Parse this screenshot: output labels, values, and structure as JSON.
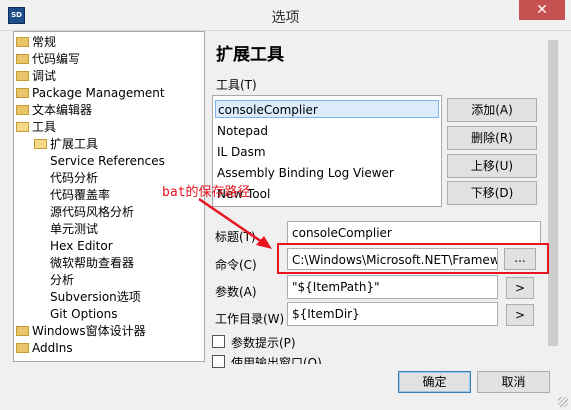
{
  "window": {
    "title": "选项",
    "icon_text": "SD",
    "close_label": "✕"
  },
  "tree": {
    "items": [
      {
        "label": "常规",
        "level": 0
      },
      {
        "label": "代码编写",
        "level": 0
      },
      {
        "label": "调试",
        "level": 0
      },
      {
        "label": "Package Management",
        "level": 0
      },
      {
        "label": "文本编辑器",
        "level": 0
      },
      {
        "label": "工具",
        "level": 0
      },
      {
        "label": "扩展工具",
        "level": 1
      },
      {
        "label": "Service References",
        "level": 1
      },
      {
        "label": "代码分析",
        "level": 1
      },
      {
        "label": "代码覆盖率",
        "level": 1
      },
      {
        "label": "源代码风格分析",
        "level": 1
      },
      {
        "label": "单元测试",
        "level": 1
      },
      {
        "label": "Hex Editor",
        "level": 1
      },
      {
        "label": "微软帮助查看器",
        "level": 1
      },
      {
        "label": "分析",
        "level": 1
      },
      {
        "label": "Subversion选项",
        "level": 1
      },
      {
        "label": "Git Options",
        "level": 1
      },
      {
        "label": "Windows窗体设计器",
        "level": 0
      },
      {
        "label": "AddIns",
        "level": 0
      }
    ]
  },
  "panel": {
    "title": "扩展工具",
    "tools_label": "工具(T)",
    "tools": [
      "consoleComplier",
      "Notepad",
      "IL Dasm",
      "Assembly Binding Log Viewer",
      "New Tool"
    ],
    "selected_tool": "consoleComplier",
    "buttons": {
      "add": "添加(A)",
      "delete": "删除(R)",
      "move_up": "上移(U)",
      "move_down": "下移(D)"
    },
    "fields": {
      "title_label": "标题(T)",
      "title_value": "consoleComplier",
      "command_label": "命令(C)",
      "command_value": "C:\\Windows\\Microsoft.NET\\Framew",
      "browse_label": "...",
      "args_label": "参数(A)",
      "args_value": "\"${ItemPath}\"",
      "workdir_label": "工作目录(W)",
      "workdir_value": "${ItemDir}",
      "arrow_label": ">"
    },
    "checkboxes": {
      "prompt_args": "参数提示(P)",
      "use_output": "使用输出窗口(O)"
    }
  },
  "annotation": {
    "text": "bat的保存路径",
    "color": "#e8141e"
  },
  "footer": {
    "ok": "确定",
    "cancel": "取消"
  }
}
